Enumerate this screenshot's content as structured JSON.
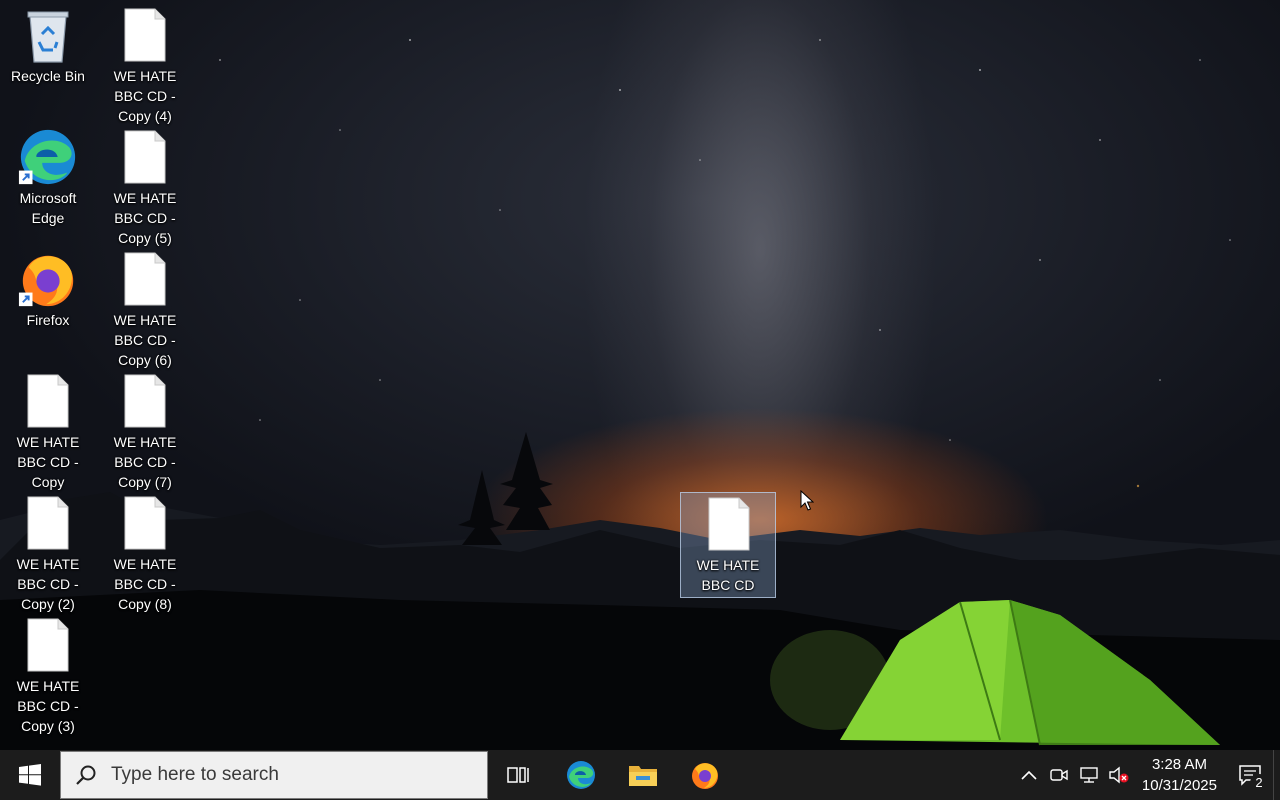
{
  "desktop": {
    "icons": [
      {
        "label": "Recycle Bin",
        "type": "recycle-bin"
      },
      {
        "label": "Microsoft Edge",
        "type": "edge"
      },
      {
        "label": "Firefox",
        "type": "firefox"
      },
      {
        "label": "WE HATE BBC CD - Copy",
        "type": "file"
      },
      {
        "label": "WE HATE BBC CD - Copy (2)",
        "type": "file"
      },
      {
        "label": "WE HATE BBC CD - Copy (3)",
        "type": "file"
      },
      {
        "label": "WE HATE BBC CD - Copy (4)",
        "type": "file"
      },
      {
        "label": "WE HATE BBC CD - Copy (5)",
        "type": "file"
      },
      {
        "label": "WE HATE BBC CD - Copy (6)",
        "type": "file"
      },
      {
        "label": "WE HATE BBC CD - Copy (7)",
        "type": "file"
      },
      {
        "label": "WE HATE BBC CD - Copy (8)",
        "type": "file"
      },
      {
        "label": "WE HATE BBC CD",
        "type": "file",
        "selected": true
      }
    ]
  },
  "taskbar": {
    "search_placeholder": "Type here to search",
    "pinned": [
      "task-view-icon",
      "edge-icon",
      "file-explorer-icon",
      "firefox-icon"
    ],
    "tray": {
      "time": "3:28 AM",
      "date": "10/31/2025",
      "notification_count": "2"
    }
  },
  "colors": {
    "taskbar": "#1c1c1c",
    "search_box": "#f0f0f0",
    "selection": "#8caad2"
  }
}
